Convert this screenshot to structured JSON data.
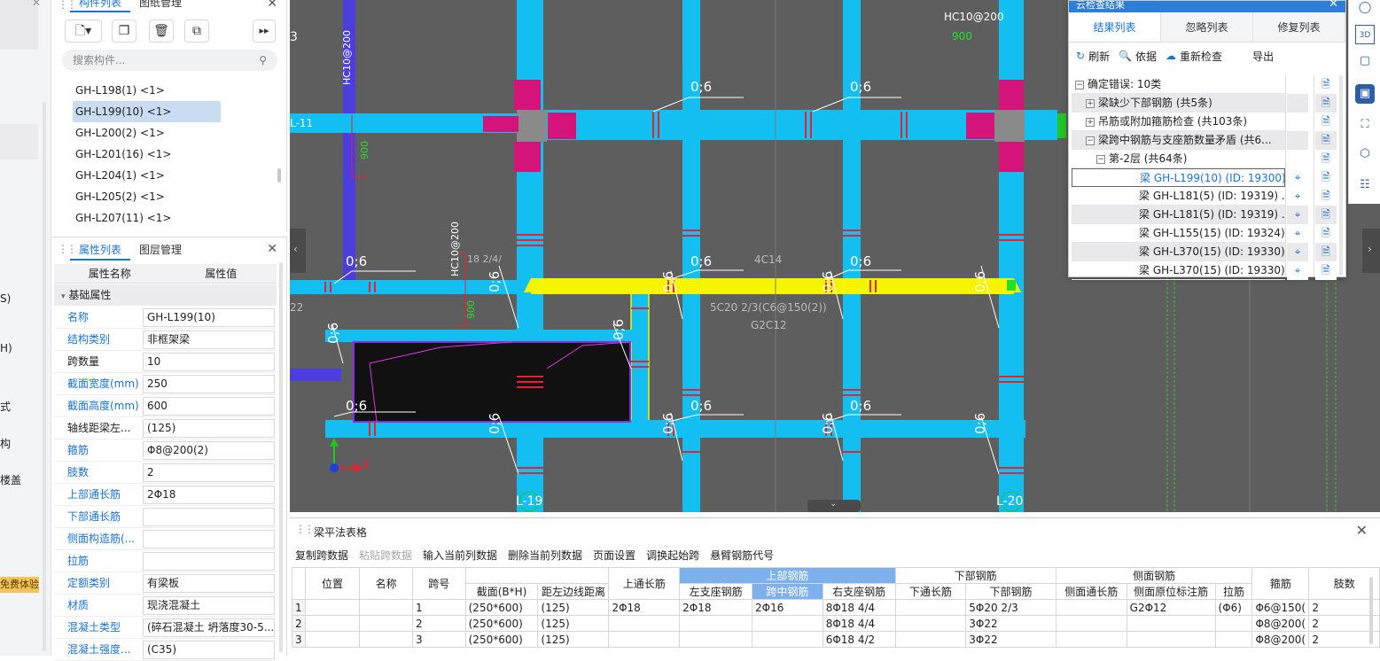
{
  "left_strip": {
    "labels": [
      "S)",
      "H)",
      "式",
      "构",
      "楼盖"
    ],
    "trial_badge": "免费体验"
  },
  "component_panel": {
    "tabs": [
      "构件列表",
      "图纸管理"
    ],
    "search_placeholder": "搜索构件...",
    "items": [
      "GH-L198(1) <1>",
      "GH-L199(10) <1>",
      "GH-L200(2) <1>",
      "GH-L201(16) <1>",
      "GH-L204(1) <1>",
      "GH-L205(2) <1>",
      "GH-L207(11) <1>"
    ],
    "selected_index": 1
  },
  "property_panel": {
    "tabs": [
      "属性列表",
      "图层管理"
    ],
    "col_name": "属性名称",
    "col_value": "属性值",
    "group": "基础属性",
    "rows": [
      {
        "k": "名称",
        "v": "GH-L199(10)",
        "blue": true
      },
      {
        "k": "结构类别",
        "v": "非框架梁",
        "blue": true
      },
      {
        "k": "跨数量",
        "v": "10",
        "blue": false
      },
      {
        "k": "截面宽度(mm)",
        "v": "250",
        "blue": true
      },
      {
        "k": "截面高度(mm)",
        "v": "600",
        "blue": true
      },
      {
        "k": "轴线距梁左...",
        "v": "(125)",
        "blue": false
      },
      {
        "k": "箍筋",
        "v": "Φ8@200(2)",
        "blue": true
      },
      {
        "k": "肢数",
        "v": "2",
        "blue": true
      },
      {
        "k": "上部通长筋",
        "v": "2Φ18",
        "blue": true
      },
      {
        "k": "下部通长筋",
        "v": "",
        "blue": true
      },
      {
        "k": "侧面构造筋(...",
        "v": "",
        "blue": true
      },
      {
        "k": "拉筋",
        "v": "",
        "blue": true
      },
      {
        "k": "定额类别",
        "v": "有梁板",
        "blue": true
      },
      {
        "k": "材质",
        "v": "现浇混凝土",
        "blue": true
      },
      {
        "k": "混凝土类型",
        "v": "(碎石混凝土 坍落度30-5...",
        "blue": true
      },
      {
        "k": "混凝土强度...",
        "v": "(C35)",
        "blue": true
      }
    ]
  },
  "canvas": {
    "labels": {
      "gh_c10": "HC10@200",
      "n900a": "900",
      "n900b": "900",
      "n900c": "900",
      "vtext1": "HC10@200",
      "vtext2": "HC10@200",
      "l11": "L-11",
      "l22": "22",
      "lab06": "0;6",
      "c14": "4C14",
      "ann1": "5C20 2/3(C6@150(2))",
      "ann2": "G2C12",
      "s18": "18 2/4/",
      "l19": "L-19",
      "l20": "L-20",
      "x_axis": "X",
      "three": "3"
    }
  },
  "check_panel": {
    "title": "云检查结果",
    "tabs": [
      "结果列表",
      "忽略列表",
      "修复列表"
    ],
    "tools": {
      "refresh": "刷新",
      "basis": "依据",
      "recheck": "重新检查",
      "export": "导出"
    },
    "rows": [
      {
        "text": "确定错误: 10类",
        "indent": 0,
        "box": "−",
        "style": ""
      },
      {
        "text": "梁缺少下部钢筋 (共5条)",
        "indent": 1,
        "box": "+",
        "style": "gray"
      },
      {
        "text": "吊筋或附加箍筋检查 (共103条)",
        "indent": 1,
        "box": "+",
        "style": ""
      },
      {
        "text": "梁跨中钢筋与支座筋数量矛盾 (共6...",
        "indent": 1,
        "box": "−",
        "style": "gray"
      },
      {
        "text": "第-2层 (共64条)",
        "indent": 2,
        "box": "−",
        "style": ""
      },
      {
        "text": "梁 GH-L199(10) (ID: 19300) ...",
        "indent": 3,
        "box": "",
        "style": "sel"
      },
      {
        "text": "梁 GH-L181(5) (ID: 19319) ...",
        "indent": 3,
        "box": "",
        "style": ""
      },
      {
        "text": "梁 GH-L181(5) (ID: 19319) ...",
        "indent": 3,
        "box": "",
        "style": "gray"
      },
      {
        "text": "梁 GH-L155(15) (ID: 19324) ...",
        "indent": 3,
        "box": "",
        "style": ""
      },
      {
        "text": "梁 GH-L370(15) (ID: 19330) ...",
        "indent": 3,
        "box": "",
        "style": "gray"
      },
      {
        "text": "梁 GH-L370(15) (ID: 19330) ...",
        "indent": 3,
        "box": "",
        "style": ""
      }
    ]
  },
  "beam_table": {
    "title": "梁平法表格",
    "toolbar": [
      {
        "label": "复制跨数据",
        "disabled": false
      },
      {
        "label": "粘贴跨数据",
        "disabled": true
      },
      {
        "label": "输入当前列数据",
        "disabled": false
      },
      {
        "label": "删除当前列数据",
        "disabled": false
      },
      {
        "label": "页面设置",
        "disabled": false
      },
      {
        "label": "调换起始跨",
        "disabled": false
      },
      {
        "label": "悬臂钢筋代号",
        "disabled": false
      }
    ],
    "head": {
      "pos": "位置",
      "name": "名称",
      "span": "跨号",
      "section": "截面(B*H)",
      "offset": "距左边线距离",
      "top_through": "上通长筋",
      "top_group": "上部钢筋",
      "left_support": "左支座钢筋",
      "mid": "跨中钢筋",
      "right_support": "右支座钢筋",
      "bottom_group": "下部钢筋",
      "bottom_through": "下通长筋",
      "bottom": "下部钢筋",
      "side_group": "侧面钢筋",
      "side_through": "侧面通长筋",
      "side_orig": "侧面原位标注筋",
      "tie": "拉筋",
      "stirrup": "箍筋",
      "legs": "肢数"
    },
    "rows": [
      {
        "n": "1",
        "pos": "",
        "name": "",
        "span": "1",
        "section": "(250*600)",
        "offset": "(125)",
        "top": "2Φ18",
        "left": "2Φ18",
        "mid": "2Φ16",
        "right": "8Φ18 4/4",
        "bthrough": "",
        "bottom": "5Φ20 2/3",
        "sthrough": "",
        "sorig": "G2Φ12",
        "tie": "(Φ6)",
        "stirrup": "Φ6@150(",
        "legs": "2"
      },
      {
        "n": "2",
        "pos": "",
        "name": "",
        "span": "2",
        "section": "(250*600)",
        "offset": "(125)",
        "top": "",
        "left": "",
        "mid": "",
        "right": "8Φ18 4/4",
        "bthrough": "",
        "bottom": "3Φ22",
        "sthrough": "",
        "sorig": "",
        "tie": "",
        "stirrup": "Φ8@200(",
        "legs": "2"
      },
      {
        "n": "3",
        "pos": "",
        "name": "",
        "span": "3",
        "section": "(250*600)",
        "offset": "(125)",
        "top": "",
        "left": "",
        "mid": "",
        "right": "6Φ18 4/2",
        "bthrough": "",
        "bottom": "3Φ22",
        "sthrough": "",
        "sorig": "",
        "tie": "",
        "stirrup": "Φ8@200(",
        "legs": "2"
      }
    ]
  }
}
